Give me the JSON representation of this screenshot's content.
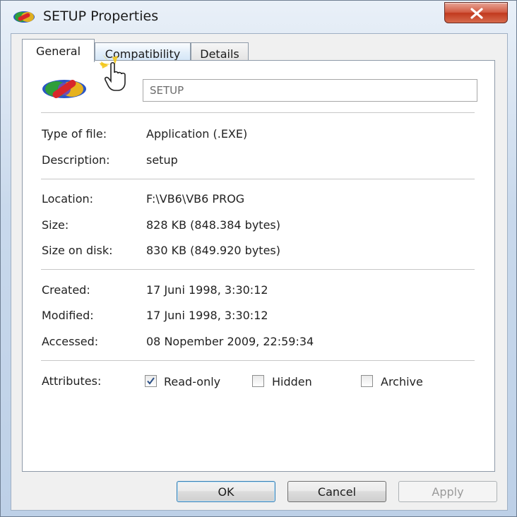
{
  "window": {
    "title": "SETUP Properties",
    "close_label": "close"
  },
  "tabs": [
    {
      "label": "General",
      "active": true
    },
    {
      "label": "Compatibility",
      "active": false
    },
    {
      "label": "Details",
      "active": false
    }
  ],
  "general": {
    "file_name": "SETUP",
    "fields": [
      {
        "label": "Type of file:",
        "value": "Application (.EXE)"
      },
      {
        "label": "Description:",
        "value": "setup"
      },
      {
        "label": "Location:",
        "value": "F:\\VB6\\VB6 PROG"
      },
      {
        "label": "Size:",
        "value": "828 KB (848.384 bytes)"
      },
      {
        "label": "Size on disk:",
        "value": "830 KB (849.920 bytes)"
      },
      {
        "label": "Created:",
        "value": "17 Juni 1998, 3:30:12"
      },
      {
        "label": "Modified:",
        "value": "17 Juni 1998, 3:30:12"
      },
      {
        "label": "Accessed:",
        "value": "08 Nopember 2009, 22:59:34"
      }
    ],
    "attributes": {
      "label": "Attributes:",
      "read_only": {
        "label": "Read-only",
        "checked": true
      },
      "hidden": {
        "label": "Hidden",
        "checked": false
      },
      "archive": {
        "label": "Archive",
        "checked": false
      }
    }
  },
  "buttons": {
    "ok": "OK",
    "cancel": "Cancel",
    "apply": "Apply"
  },
  "colors": {
    "accent": "#3c7fb1",
    "close_button": "#c1391e"
  },
  "icons": {
    "app_icon": "vb6-setup-icon",
    "cursor": "hand-pointer-icon"
  }
}
